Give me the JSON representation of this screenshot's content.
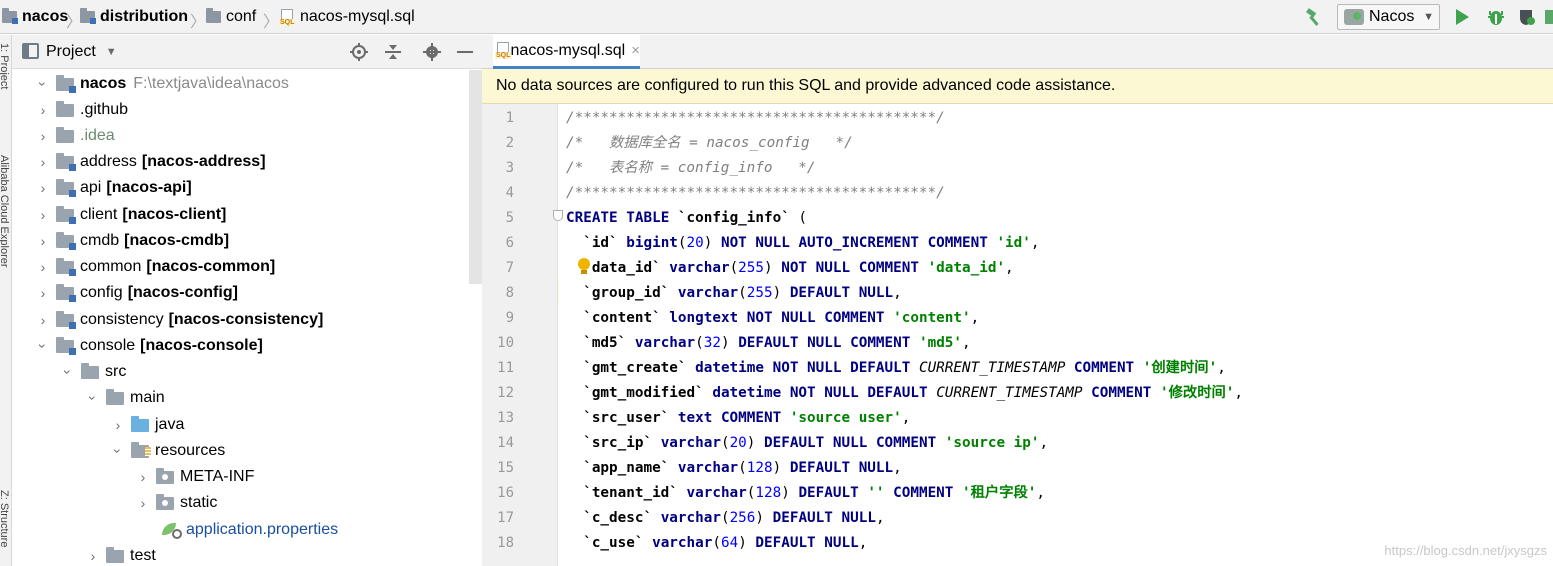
{
  "breadcrumbs": [
    {
      "label": "nacos",
      "bold": true
    },
    {
      "label": "distribution",
      "bold": true
    },
    {
      "label": "conf",
      "bold": false
    },
    {
      "label": "nacos-mysql.sql",
      "bold": false
    }
  ],
  "run_config": {
    "selected": "Nacos"
  },
  "left_strip": {
    "labels": [
      "1: Project",
      "Alibaba Cloud Explorer",
      "Z: Structure"
    ]
  },
  "project_panel": {
    "title": "Project",
    "tree": [
      {
        "name": "nacos",
        "path": "F:\\textjava\\idea\\nacos"
      },
      {
        "name": ".github"
      },
      {
        "name": ".idea"
      },
      {
        "name": "address",
        "module": "[nacos-address]"
      },
      {
        "name": "api",
        "module": "[nacos-api]"
      },
      {
        "name": "client",
        "module": "[nacos-client]"
      },
      {
        "name": "cmdb",
        "module": "[nacos-cmdb]"
      },
      {
        "name": "common",
        "module": "[nacos-common]"
      },
      {
        "name": "config",
        "module": "[nacos-config]"
      },
      {
        "name": "consistency",
        "module": "[nacos-consistency]"
      },
      {
        "name": "console",
        "module": "[nacos-console]"
      },
      {
        "name": "src"
      },
      {
        "name": "main"
      },
      {
        "name": "java"
      },
      {
        "name": "resources"
      },
      {
        "name": "META-INF"
      },
      {
        "name": "static"
      },
      {
        "name": "application.properties"
      },
      {
        "name": "test"
      }
    ]
  },
  "editor": {
    "tab_label": "nacos-mysql.sql",
    "banner": "No data sources are configured to run this SQL and provide advanced code assistance.",
    "line_numbers": [
      "1",
      "2",
      "3",
      "4",
      "5",
      "6",
      "7",
      "8",
      "9",
      "10",
      "11",
      "12",
      "13",
      "14",
      "15",
      "16",
      "17",
      "18"
    ],
    "lines": [
      "/******************************************/",
      "/*   数据库全名 = nacos_config   */",
      "/*   表名称 = config_info   */",
      "/******************************************/",
      "CREATE TABLE `config_info` (",
      "  `id` bigint(20) NOT NULL AUTO_INCREMENT COMMENT 'id',",
      "  `data_id` varchar(255) NOT NULL COMMENT 'data_id',",
      "  `group_id` varchar(255) DEFAULT NULL,",
      "  `content` longtext NOT NULL COMMENT 'content',",
      "  `md5` varchar(32) DEFAULT NULL COMMENT 'md5',",
      "  `gmt_create` datetime NOT NULL DEFAULT CURRENT_TIMESTAMP COMMENT '创建时间',",
      "  `gmt_modified` datetime NOT NULL DEFAULT CURRENT_TIMESTAMP COMMENT '修改时间',",
      "  `src_user` text COMMENT 'source user',",
      "  `src_ip` varchar(20) DEFAULT NULL COMMENT 'source ip',",
      "  `app_name` varchar(128) DEFAULT NULL,",
      "  `tenant_id` varchar(128) DEFAULT '' COMMENT '租户字段',",
      "  `c_desc` varchar(256) DEFAULT NULL,",
      "  `c_use` varchar(64) DEFAULT NULL,"
    ]
  },
  "watermark": "https://blog.csdn.net/jxysgzs",
  "colors": {
    "keyword": "#000080",
    "string": "#008000",
    "number": "#0000ff",
    "comment": "#808080",
    "banner_bg": "#fcf8d4",
    "tab_underline": "#4083c9"
  }
}
